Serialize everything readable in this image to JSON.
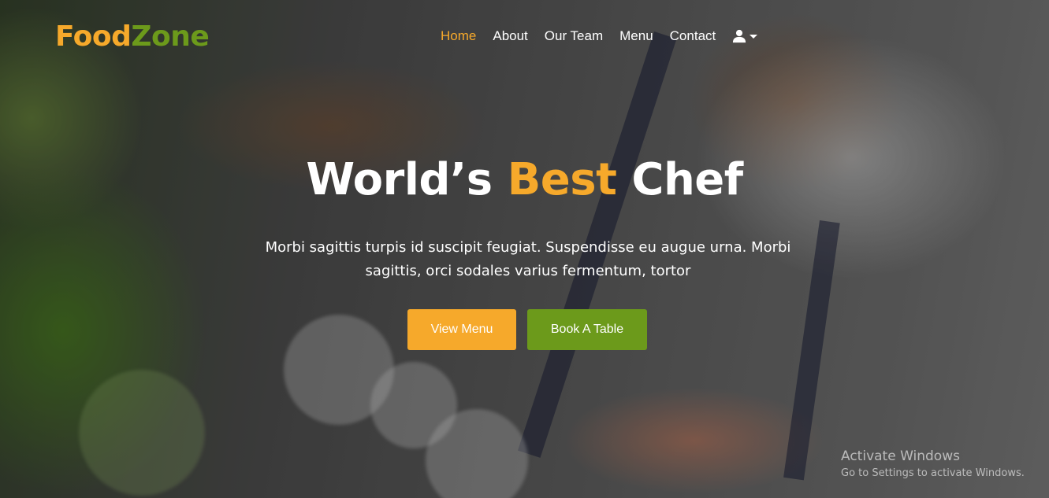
{
  "brand": {
    "part1": "Food",
    "part2": "Zone"
  },
  "nav": {
    "items": [
      {
        "label": "Home",
        "active": true
      },
      {
        "label": "About"
      },
      {
        "label": "Our Team"
      },
      {
        "label": "Menu"
      },
      {
        "label": "Contact"
      }
    ],
    "user_icon": "user-icon"
  },
  "hero": {
    "title_before": "World’s ",
    "title_highlight": "Best",
    "title_after": " Chef",
    "subtitle": "Morbi sagittis turpis id suscipit feugiat. Suspendisse eu augue urna. Morbi sagittis, orci sodales varius fermentum, tortor",
    "primary_button": "View Menu",
    "secondary_button": "Book A Table"
  },
  "watermark": {
    "line1": "Activate Windows",
    "line2": "Go to Settings to activate Windows."
  },
  "colors": {
    "accent": "#f6a92b",
    "green": "#6c9a1b",
    "text": "#ffffff"
  }
}
